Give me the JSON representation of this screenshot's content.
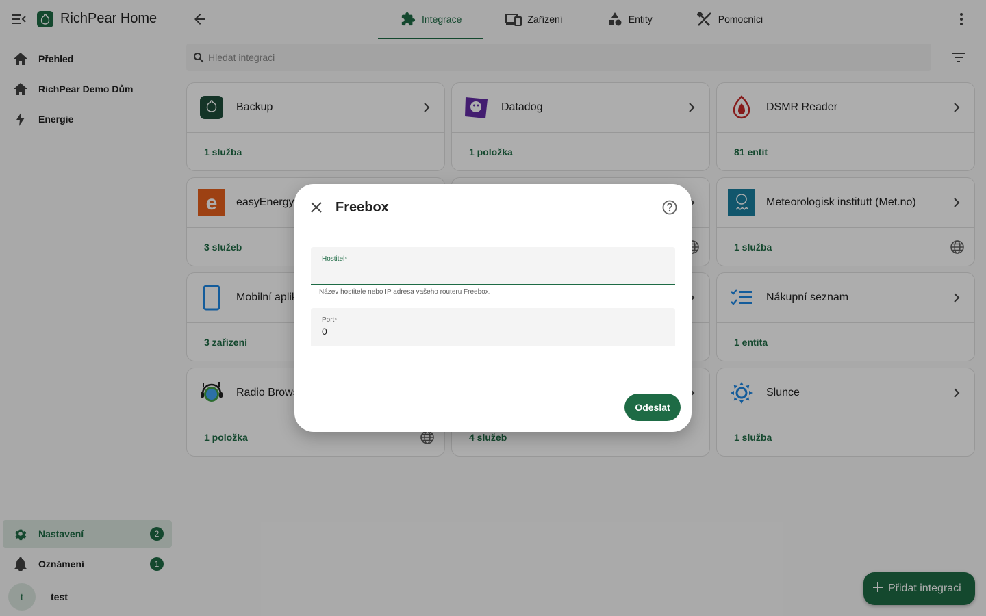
{
  "app": {
    "title": "RichPear Home"
  },
  "sidebar": {
    "items": [
      {
        "label": "Přehled",
        "icon": "home-icon"
      },
      {
        "label": "RichPear Demo Dům",
        "icon": "home-outline-icon"
      },
      {
        "label": "Energie",
        "icon": "lightning-icon"
      }
    ],
    "bottom": [
      {
        "label": "Nastavení",
        "icon": "gear-icon",
        "badge": "2"
      },
      {
        "label": "Oznámení",
        "icon": "bell-icon",
        "badge": "1"
      }
    ],
    "user": {
      "initial": "t",
      "name": "test"
    }
  },
  "tabs": [
    {
      "label": "Integrace",
      "icon": "puzzle-icon",
      "active": true
    },
    {
      "label": "Zařízení",
      "icon": "devices-icon"
    },
    {
      "label": "Entity",
      "icon": "shapes-icon"
    },
    {
      "label": "Pomocníci",
      "icon": "tools-icon"
    }
  ],
  "search": {
    "placeholder": "Hledat integraci"
  },
  "cards": [
    {
      "name": "Backup",
      "count": "1 služba",
      "globe": false
    },
    {
      "name": "Datadog",
      "count": "1 položka",
      "globe": false
    },
    {
      "name": "DSMR Reader",
      "count": "81 entit",
      "globe": false
    },
    {
      "name": "easyEnergy",
      "count": "3 služeb",
      "globe": false
    },
    {
      "name": "",
      "count": "",
      "globe": true
    },
    {
      "name": "Meteorologisk institutt (Met.no)",
      "count": "1 služba",
      "globe": true
    },
    {
      "name": "Mobilní aplik",
      "count": "3 zařízení",
      "globe": false
    },
    {
      "name": "",
      "count": "",
      "globe": false
    },
    {
      "name": "Nákupní seznam",
      "count": "1 entita",
      "globe": false
    },
    {
      "name": "Radio Brows",
      "count": "1 položka",
      "globe": true
    },
    {
      "name": "",
      "count": "4 služeb",
      "globe": false
    },
    {
      "name": "Slunce",
      "count": "1 služba",
      "globe": false
    }
  ],
  "fab": {
    "label": "Přidat integraci"
  },
  "dialog": {
    "title": "Freebox",
    "host": {
      "label": "Hostitel*",
      "value": "",
      "helper": "Název hostitele nebo IP adresa vašeho routeru Freebox."
    },
    "port": {
      "label": "Port*",
      "value": "0"
    },
    "submit_label": "Odeslat"
  },
  "colors": {
    "primary": "#1e6b45"
  }
}
